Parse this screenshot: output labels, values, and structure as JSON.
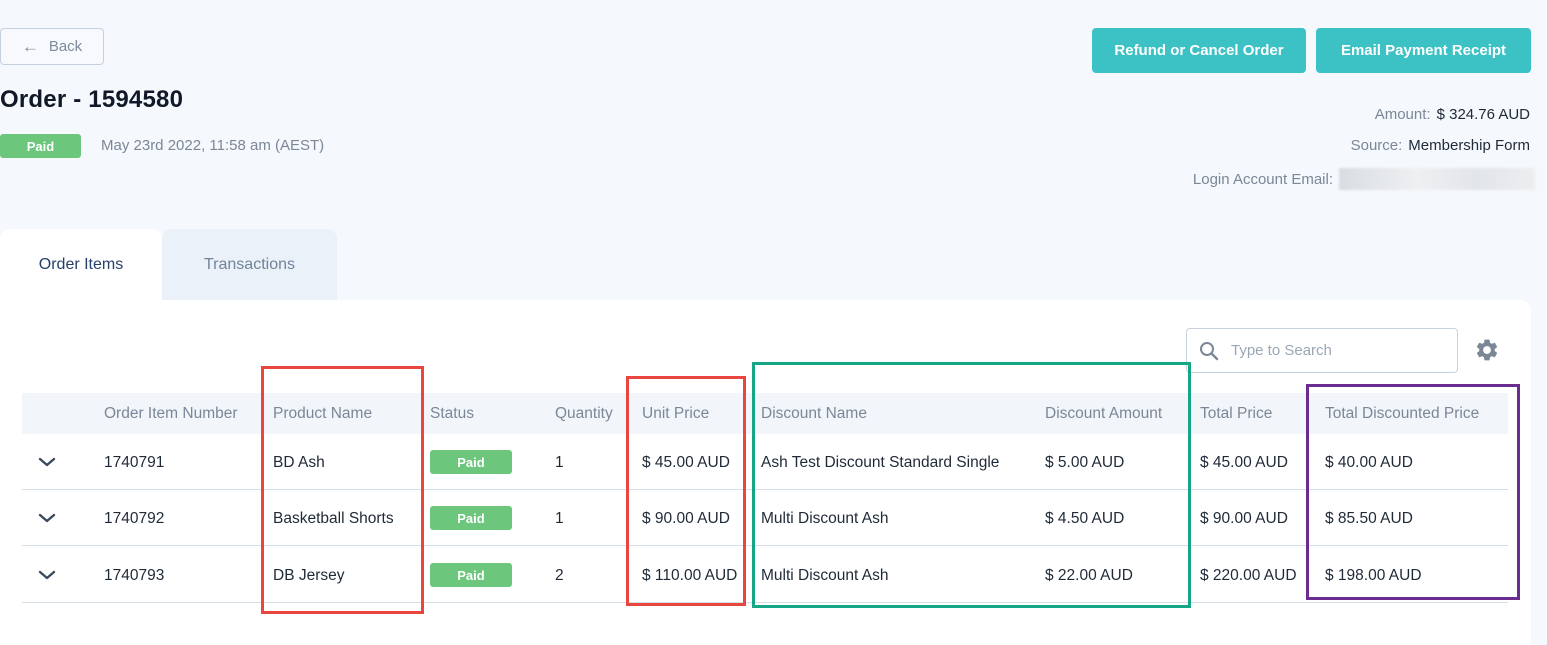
{
  "header": {
    "back_label": "Back",
    "order_title": "Order - 1594580",
    "status": "Paid",
    "date": "May 23rd 2022, 11:58 am (AEST)",
    "refund_button": "Refund or Cancel Order",
    "email_button": "Email Payment Receipt",
    "amount_label": "Amount:",
    "amount_value": "$ 324.76 AUD",
    "source_label": "Source:",
    "source_value": "Membership Form",
    "email_label": "Login Account Email:"
  },
  "tabs": [
    {
      "label": "Order Items",
      "active": true
    },
    {
      "label": "Transactions",
      "active": false
    }
  ],
  "search": {
    "placeholder": "Type to Search"
  },
  "table": {
    "columns": [
      "Order Item Number",
      "Product Name",
      "Status",
      "Quantity",
      "Unit Price",
      "Discount Name",
      "Discount Amount",
      "Total Price",
      "Total Discounted Price"
    ],
    "rows": [
      {
        "item_number": "1740791",
        "product": "BD Ash",
        "status": "Paid",
        "quantity": "1",
        "unit_price": "$ 45.00 AUD",
        "discount_name": "Ash Test Discount Standard Single",
        "discount_amount": "$ 5.00 AUD",
        "total_price": "$ 45.00 AUD",
        "total_discounted": "$ 40.00 AUD"
      },
      {
        "item_number": "1740792",
        "product": "Basketball Shorts",
        "status": "Paid",
        "quantity": "1",
        "unit_price": "$ 90.00 AUD",
        "discount_name": "Multi Discount Ash",
        "discount_amount": "$ 4.50 AUD",
        "total_price": "$ 90.00 AUD",
        "total_discounted": "$ 85.50 AUD"
      },
      {
        "item_number": "1740793",
        "product": "DB Jersey",
        "status": "Paid",
        "quantity": "2",
        "unit_price": "$ 110.00 AUD",
        "discount_name": "Multi Discount Ash",
        "discount_amount": "$ 22.00 AUD",
        "total_price": "$ 220.00 AUD",
        "total_discounted": "$ 198.00 AUD"
      }
    ]
  },
  "colors": {
    "accent": "#3cc2c5",
    "paid": "#6cc77c",
    "highlight_red": "#e8463f",
    "highlight_green": "#15a686",
    "highlight_purple": "#6a2c8f"
  }
}
